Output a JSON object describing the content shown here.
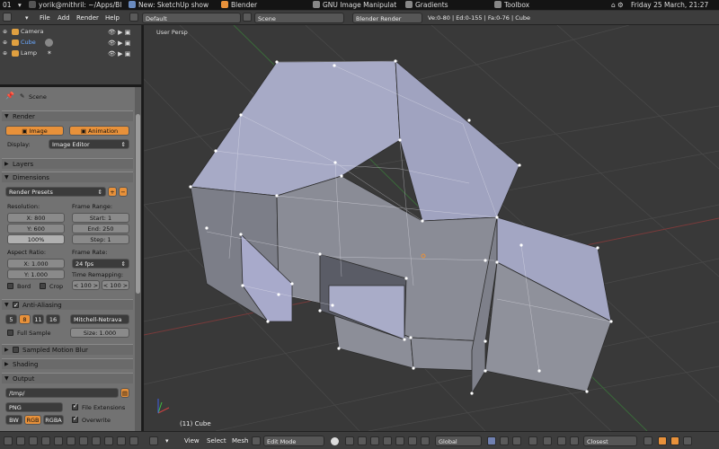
{
  "taskbar": {
    "workspace": "01",
    "terminal": "yorik@mithril: ~/Apps/Bl",
    "sketchup": "New: SketchUp show",
    "blender": "Blender",
    "gimp": "GNU Image Manipulat",
    "gradients": "Gradients",
    "toolbox": "Toolbox",
    "clock": "Friday 25 March, 21:27"
  },
  "menubar": {
    "menus": [
      "File",
      "Add",
      "Render",
      "Help"
    ],
    "screen_layout": "Default",
    "scene": "Scene",
    "engine": "Blender Render",
    "stats": "Ve:0-80 | Ed:0-155 | Fa:0-76 | Cube"
  },
  "outliner": {
    "items": [
      {
        "name": "Camera",
        "icon": "camera-icon",
        "color": "#e0a040"
      },
      {
        "name": "Cube",
        "icon": "mesh-icon",
        "color": "#e0a040",
        "selected": true
      },
      {
        "name": "Lamp",
        "icon": "lamp-icon",
        "color": "#e0a040"
      }
    ]
  },
  "properties": {
    "context": "Scene",
    "render": {
      "title": "Render",
      "image_btn": "Image",
      "animation_btn": "Animation",
      "display_label": "Display:",
      "display_value": "Image Editor"
    },
    "layers": "Layers",
    "dimensions": {
      "title": "Dimensions",
      "presets": "Render Presets",
      "resolution_label": "Resolution:",
      "res_x": "X: 800",
      "res_y": "Y: 600",
      "res_pct": "100%",
      "frame_range_label": "Frame Range:",
      "start": "Start: 1",
      "end": "End: 250",
      "step": "Step: 1",
      "aspect_label": "Aspect Ratio:",
      "asp_x": "X: 1.000",
      "asp_y": "Y: 1.000",
      "frame_rate_label": "Frame Rate:",
      "fps": "24 fps",
      "time_remap_label": "Time Remapping:",
      "remap_old": "< 100 >",
      "remap_new": "< 100 >",
      "border": "Bord",
      "crop": "Crop"
    },
    "anti_aliasing": {
      "title": "Anti-Aliasing",
      "samples": [
        "5",
        "8",
        "11",
        "16"
      ],
      "filter": "Mitchell-Netrava",
      "full_sample": "Full Sample",
      "size": "Size: 1.000"
    },
    "motion_blur": "Sampled Motion Blur",
    "shading": "Shading",
    "output": {
      "title": "Output",
      "path": "/tmp/",
      "format": "PNG",
      "file_ext": "File Extensions",
      "bw": "BW",
      "rgb": "RGB",
      "rgba": "RGBA",
      "overwrite": "Overwrite"
    }
  },
  "viewport": {
    "label": "User Persp",
    "object_info": "(11) Cube"
  },
  "bottombar": {
    "menus": [
      "View",
      "Select",
      "Mesh"
    ],
    "mode": "Edit Mode",
    "orientation": "Global",
    "snap": "Closest"
  },
  "colors": {
    "accent": "#e8913a",
    "mesh_face": "#a8acc8",
    "mesh_dark": "#7c7f8c",
    "vertex": "#ffffff"
  }
}
